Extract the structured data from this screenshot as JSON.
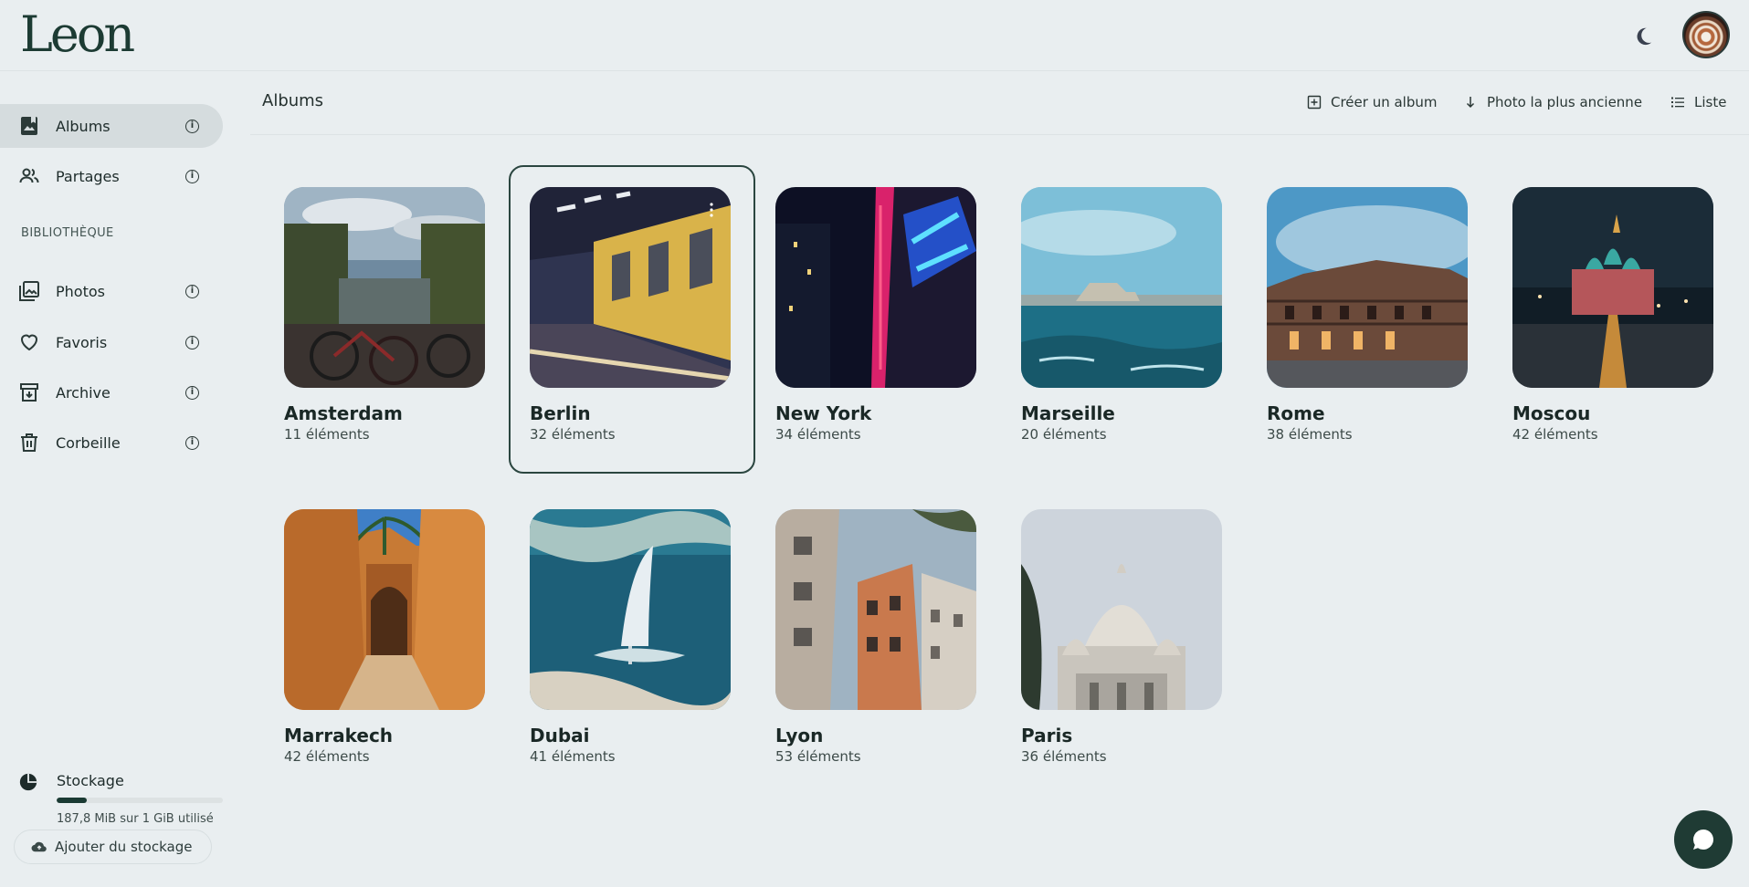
{
  "header": {
    "logo": "Leon",
    "theme_icon": "moon-icon",
    "avatar_icon": "avatar"
  },
  "sidebar": {
    "items": [
      {
        "label": "Albums",
        "icon": "album-icon",
        "active": true
      },
      {
        "label": "Partages",
        "icon": "people-icon",
        "active": false
      },
      {
        "label": "Photos",
        "icon": "photos-icon",
        "active": false
      },
      {
        "label": "Favoris",
        "icon": "heart-icon",
        "active": false
      },
      {
        "label": "Archive",
        "icon": "archive-icon",
        "active": false
      },
      {
        "label": "Corbeille",
        "icon": "trash-icon",
        "active": false
      }
    ],
    "section_label": "BIBLIOTHÈQUE",
    "storage": {
      "label": "Stockage",
      "usage_text": "187,8 MiB sur 1 GiB utilisé",
      "used_fraction": 0.18,
      "add_label": "Ajouter du stockage"
    }
  },
  "main": {
    "title": "Albums",
    "toolbar": {
      "create": "Créer un album",
      "sort": "Photo la plus ancienne",
      "view": "Liste"
    },
    "albums": [
      {
        "name": "Amsterdam",
        "count": "11 éléments"
      },
      {
        "name": "Berlin",
        "count": "32 éléments",
        "selected": true
      },
      {
        "name": "New York",
        "count": "34 éléments"
      },
      {
        "name": "Marseille",
        "count": "20 éléments"
      },
      {
        "name": "Rome",
        "count": "38 éléments"
      },
      {
        "name": "Moscou",
        "count": "42 éléments"
      },
      {
        "name": "Marrakech",
        "count": "42 éléments"
      },
      {
        "name": "Dubai",
        "count": "41 éléments"
      },
      {
        "name": "Lyon",
        "count": "53 éléments"
      },
      {
        "name": "Paris",
        "count": "36 éléments"
      }
    ]
  },
  "colors": {
    "accent": "#1f3b34",
    "background": "#e9eef0",
    "active_nav": "#d5dcde"
  }
}
